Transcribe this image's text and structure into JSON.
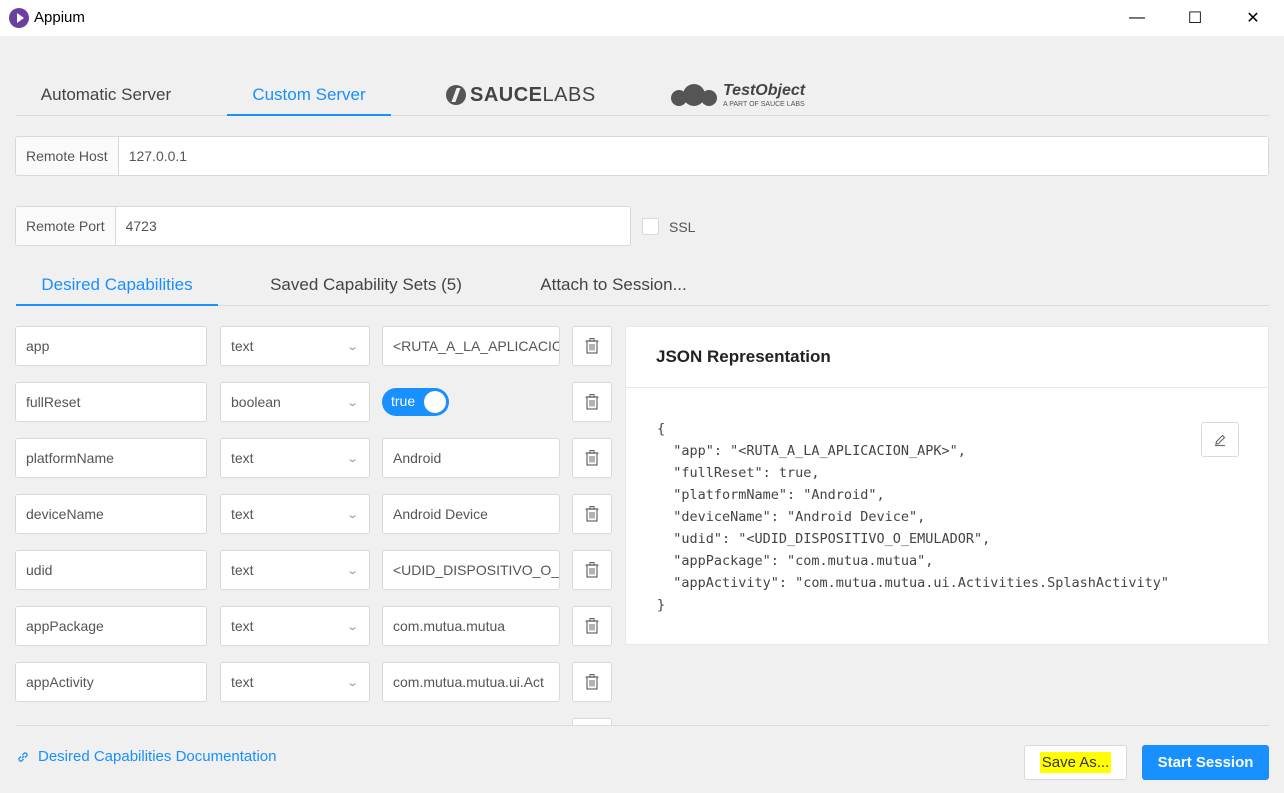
{
  "window": {
    "title": "Appium",
    "minimize": "—",
    "maximize": "☐",
    "close": "✕"
  },
  "server_tabs": [
    {
      "label": "Automatic Server"
    },
    {
      "label": "Custom Server"
    }
  ],
  "logos": {
    "saucelabs": {
      "bold": "SAUCE",
      "light": "LABS"
    },
    "testobject": {
      "main": "TestObject",
      "sub": "A PART OF SAUCE LABS"
    }
  },
  "remote_host": {
    "label": "Remote Host",
    "value": "127.0.0.1"
  },
  "remote_port": {
    "label": "Remote Port",
    "value": "4723"
  },
  "ssl": {
    "label": "SSL",
    "checked": false
  },
  "capability_tabs": [
    {
      "label": "Desired Capabilities"
    },
    {
      "label": "Saved Capability Sets (5)"
    },
    {
      "label": "Attach to Session..."
    }
  ],
  "capabilities": [
    {
      "name": "app",
      "type": "text",
      "value": "<RUTA_A_LA_APLICACIC"
    },
    {
      "name": "fullReset",
      "type": "boolean",
      "value": "true"
    },
    {
      "name": "platformName",
      "type": "text",
      "value": "Android"
    },
    {
      "name": "deviceName",
      "type": "text",
      "value": "Android Device"
    },
    {
      "name": "udid",
      "type": "text",
      "value": "<UDID_DISPOSITIVO_O_"
    },
    {
      "name": "appPackage",
      "type": "text",
      "value": "com.mutua.mutua"
    },
    {
      "name": "appActivity",
      "type": "text",
      "value": "com.mutua.mutua.ui.Act"
    }
  ],
  "json_panel": {
    "title": "JSON Representation",
    "content": "{\n  \"app\": \"<RUTA_A_LA_APLICACION_APK>\",\n  \"fullReset\": true,\n  \"platformName\": \"Android\",\n  \"deviceName\": \"Android Device\",\n  \"udid\": \"<UDID_DISPOSITIVO_O_EMULADOR\",\n  \"appPackage\": \"com.mutua.mutua\",\n  \"appActivity\": \"com.mutua.mutua.ui.Activities.SplashActivity\"\n}"
  },
  "footer": {
    "doc_link": "Desired Capabilities Documentation",
    "save_as": "Save As...",
    "start_session": "Start Session"
  },
  "colors": {
    "accent": "#1890ff",
    "highlight": "#ffff00"
  }
}
